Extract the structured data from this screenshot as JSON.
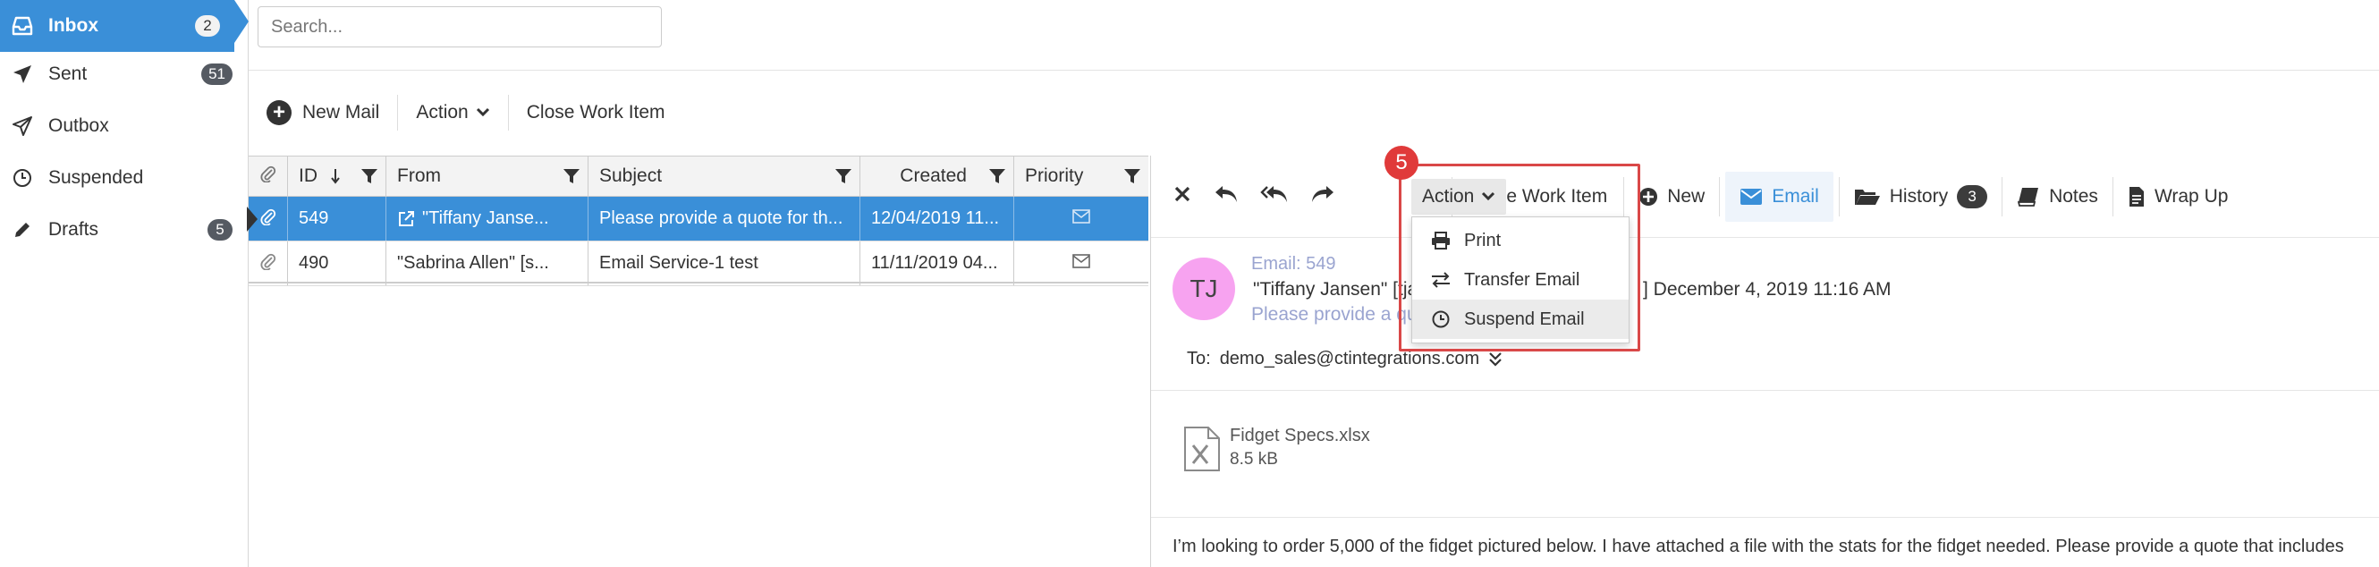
{
  "sidebar": {
    "items": [
      {
        "label": "Inbox",
        "badge": "2",
        "icon": "inbox-icon",
        "active": true
      },
      {
        "label": "Sent",
        "badge": "51",
        "icon": "paper-plane-icon"
      },
      {
        "label": "Outbox",
        "badge": "",
        "icon": "paper-plane-outline-icon"
      },
      {
        "label": "Suspended",
        "badge": "",
        "icon": "clock-icon"
      },
      {
        "label": "Drafts",
        "badge": "5",
        "icon": "pencil-icon"
      }
    ]
  },
  "search": {
    "placeholder": "Search...",
    "value": ""
  },
  "mail_toolbar": {
    "new_mail": "New Mail",
    "action": "Action",
    "close_work_item": "Close Work Item"
  },
  "table": {
    "columns": [
      "ID",
      "From",
      "Subject",
      "Created",
      "Priority"
    ],
    "rows": [
      {
        "id": "549",
        "from": "\"Tiffany Janse...",
        "subject": "Please provide a quote for th...",
        "created": "12/04/2019 11...",
        "selected": true
      },
      {
        "id": "490",
        "from": "\"Sabrina Allen\" [s...",
        "subject": "Email Service-1 test",
        "created": "11/11/2019 04...",
        "selected": false
      }
    ]
  },
  "reading_pane": {
    "toolbar": {
      "action": "Action",
      "close_work_item": "Close Work Item",
      "new": "New",
      "email": "Email",
      "history": "History",
      "history_count": "3",
      "notes": "Notes",
      "wrap_up": "Wrap Up"
    },
    "avatar_initials": "TJ",
    "email_id_line": "Email: 549",
    "from_visible": "\"Tiffany Jansen\" [tja",
    "date": "] December 4, 2019 11:16 AM",
    "subject_visible": "Please provide a qu",
    "to_label": "To:",
    "to_address": "demo_sales@ctintegrations.com",
    "attachment": {
      "name": "Fidget Specs.xlsx",
      "size": "8.5 kB"
    },
    "body_preview": "I’m looking to order 5,000 of the fidget pictured below. I have attached a file with the stats for the fidget needed. Please provide a quote that includes"
  },
  "action_menu": {
    "step": "5",
    "items": [
      {
        "label": "Print",
        "icon": "printer-icon"
      },
      {
        "label": "Transfer Email",
        "icon": "transfer-arrows-icon"
      },
      {
        "label": "Suspend Email",
        "icon": "clock-icon",
        "hover": true
      }
    ]
  },
  "colors": {
    "accent": "#3a8fd8",
    "highlight": "#d94848",
    "avatar": "#f7a3f0",
    "badge_dark": "#555a62"
  }
}
